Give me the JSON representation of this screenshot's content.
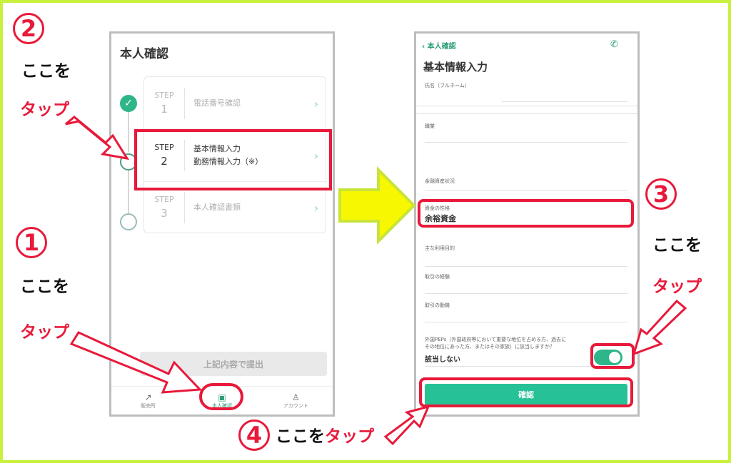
{
  "annotations": {
    "num1": "1",
    "num2": "2",
    "num3": "3",
    "num4": "4",
    "koko_wo": "ここを",
    "tap": "タップ",
    "koko_wo_tap_part1": "ここを",
    "koko_wo_tap_part2": "タップ"
  },
  "left_screen": {
    "title": "本人確認",
    "steps": [
      {
        "step_label": "STEP",
        "step_no": "1",
        "text1": "電話番号確認",
        "text2": "",
        "status": "done"
      },
      {
        "step_label": "STEP",
        "step_no": "2",
        "text1": "基本情報入力",
        "text2": "勤務情報入力（※）",
        "status": "active"
      },
      {
        "step_label": "STEP",
        "step_no": "3",
        "text1": "本人確認書類",
        "text2": "",
        "status": "todo"
      }
    ],
    "submit_label": "上記内容で提出",
    "tabs": [
      {
        "label": "販売所",
        "icon": "chart-icon"
      },
      {
        "label": "本人確認",
        "icon": "id-card-icon"
      },
      {
        "label": "アカウント",
        "icon": "user-icon"
      }
    ]
  },
  "right_screen": {
    "back_label": "本人確認",
    "title": "基本情報入力",
    "fields": {
      "name_label": "氏名（フルネーム）",
      "job_label": "職業",
      "asset_label": "金融資産状況",
      "fund_label": "資金の性格",
      "fund_value": "余裕資金",
      "purpose_label": "主な利用目的",
      "experience_label": "取引の経験",
      "motive_label": "取引の動機",
      "peps_label_1": "外国PEPs（外国政府等において重要な地位を占める方、過去に",
      "peps_label_2": "その地位にあった方、またはその家族）に該当しますか？",
      "peps_value": "該当しない",
      "peps_toggle_on": true
    },
    "confirm_label": "確認"
  },
  "colors": {
    "accent_green": "#27c196",
    "annotation_red": "#e8193a",
    "frame": "#c9f03c",
    "arrow_yellow": "#f6f700"
  }
}
